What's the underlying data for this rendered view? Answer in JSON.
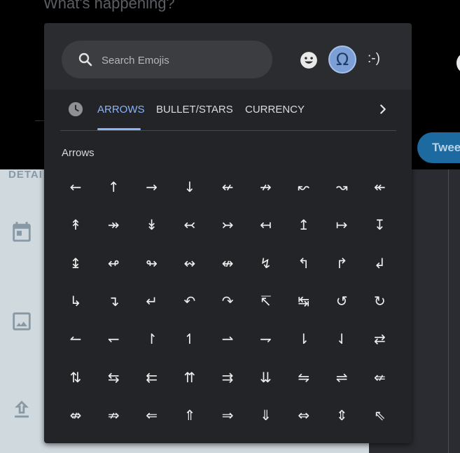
{
  "compose": {
    "placeholder": "What's happening?",
    "tweet_label": "Twee"
  },
  "details": {
    "label": "DETAI"
  },
  "picker": {
    "search": {
      "placeholder": "Search Emojis"
    },
    "modes": {
      "symbols_glyph": "Ω",
      "emoticon_label": ":-)"
    },
    "tabs": [
      "ARROWS",
      "BULLET/STARS",
      "CURRENCY"
    ],
    "section_title": "Arrows",
    "symbols": [
      [
        "←",
        "↑",
        "→",
        "↓",
        "↚",
        "↛",
        "↜",
        "↝",
        "↞"
      ],
      [
        "↟",
        "↠",
        "↡",
        "↢",
        "↣",
        "↤",
        "↥",
        "↦",
        "↧"
      ],
      [
        "↨",
        "↫",
        "↬",
        "↭",
        "↮",
        "↯",
        "↰",
        "↱",
        "↲"
      ],
      [
        "↳",
        "↴",
        "↵",
        "↶",
        "↷",
        "↸",
        "↹",
        "↺",
        "↻"
      ],
      [
        "↼",
        "↽",
        "↾",
        "↿",
        "⇀",
        "⇁",
        "⇂",
        "⇃",
        "⇄"
      ],
      [
        "⇅",
        "⇆",
        "⇇",
        "⇈",
        "⇉",
        "⇊",
        "⇋",
        "⇌",
        "⇍"
      ],
      [
        "⇎",
        "⇏",
        "⇐",
        "⇑",
        "⇒",
        "⇓",
        "⇔",
        "⇕",
        "⇖"
      ]
    ]
  },
  "colors": {
    "accent": "#8ab4f8",
    "picker_bg": "#232427",
    "header_bg": "#2b2c30",
    "tweet_button": "#1d6aa0"
  }
}
